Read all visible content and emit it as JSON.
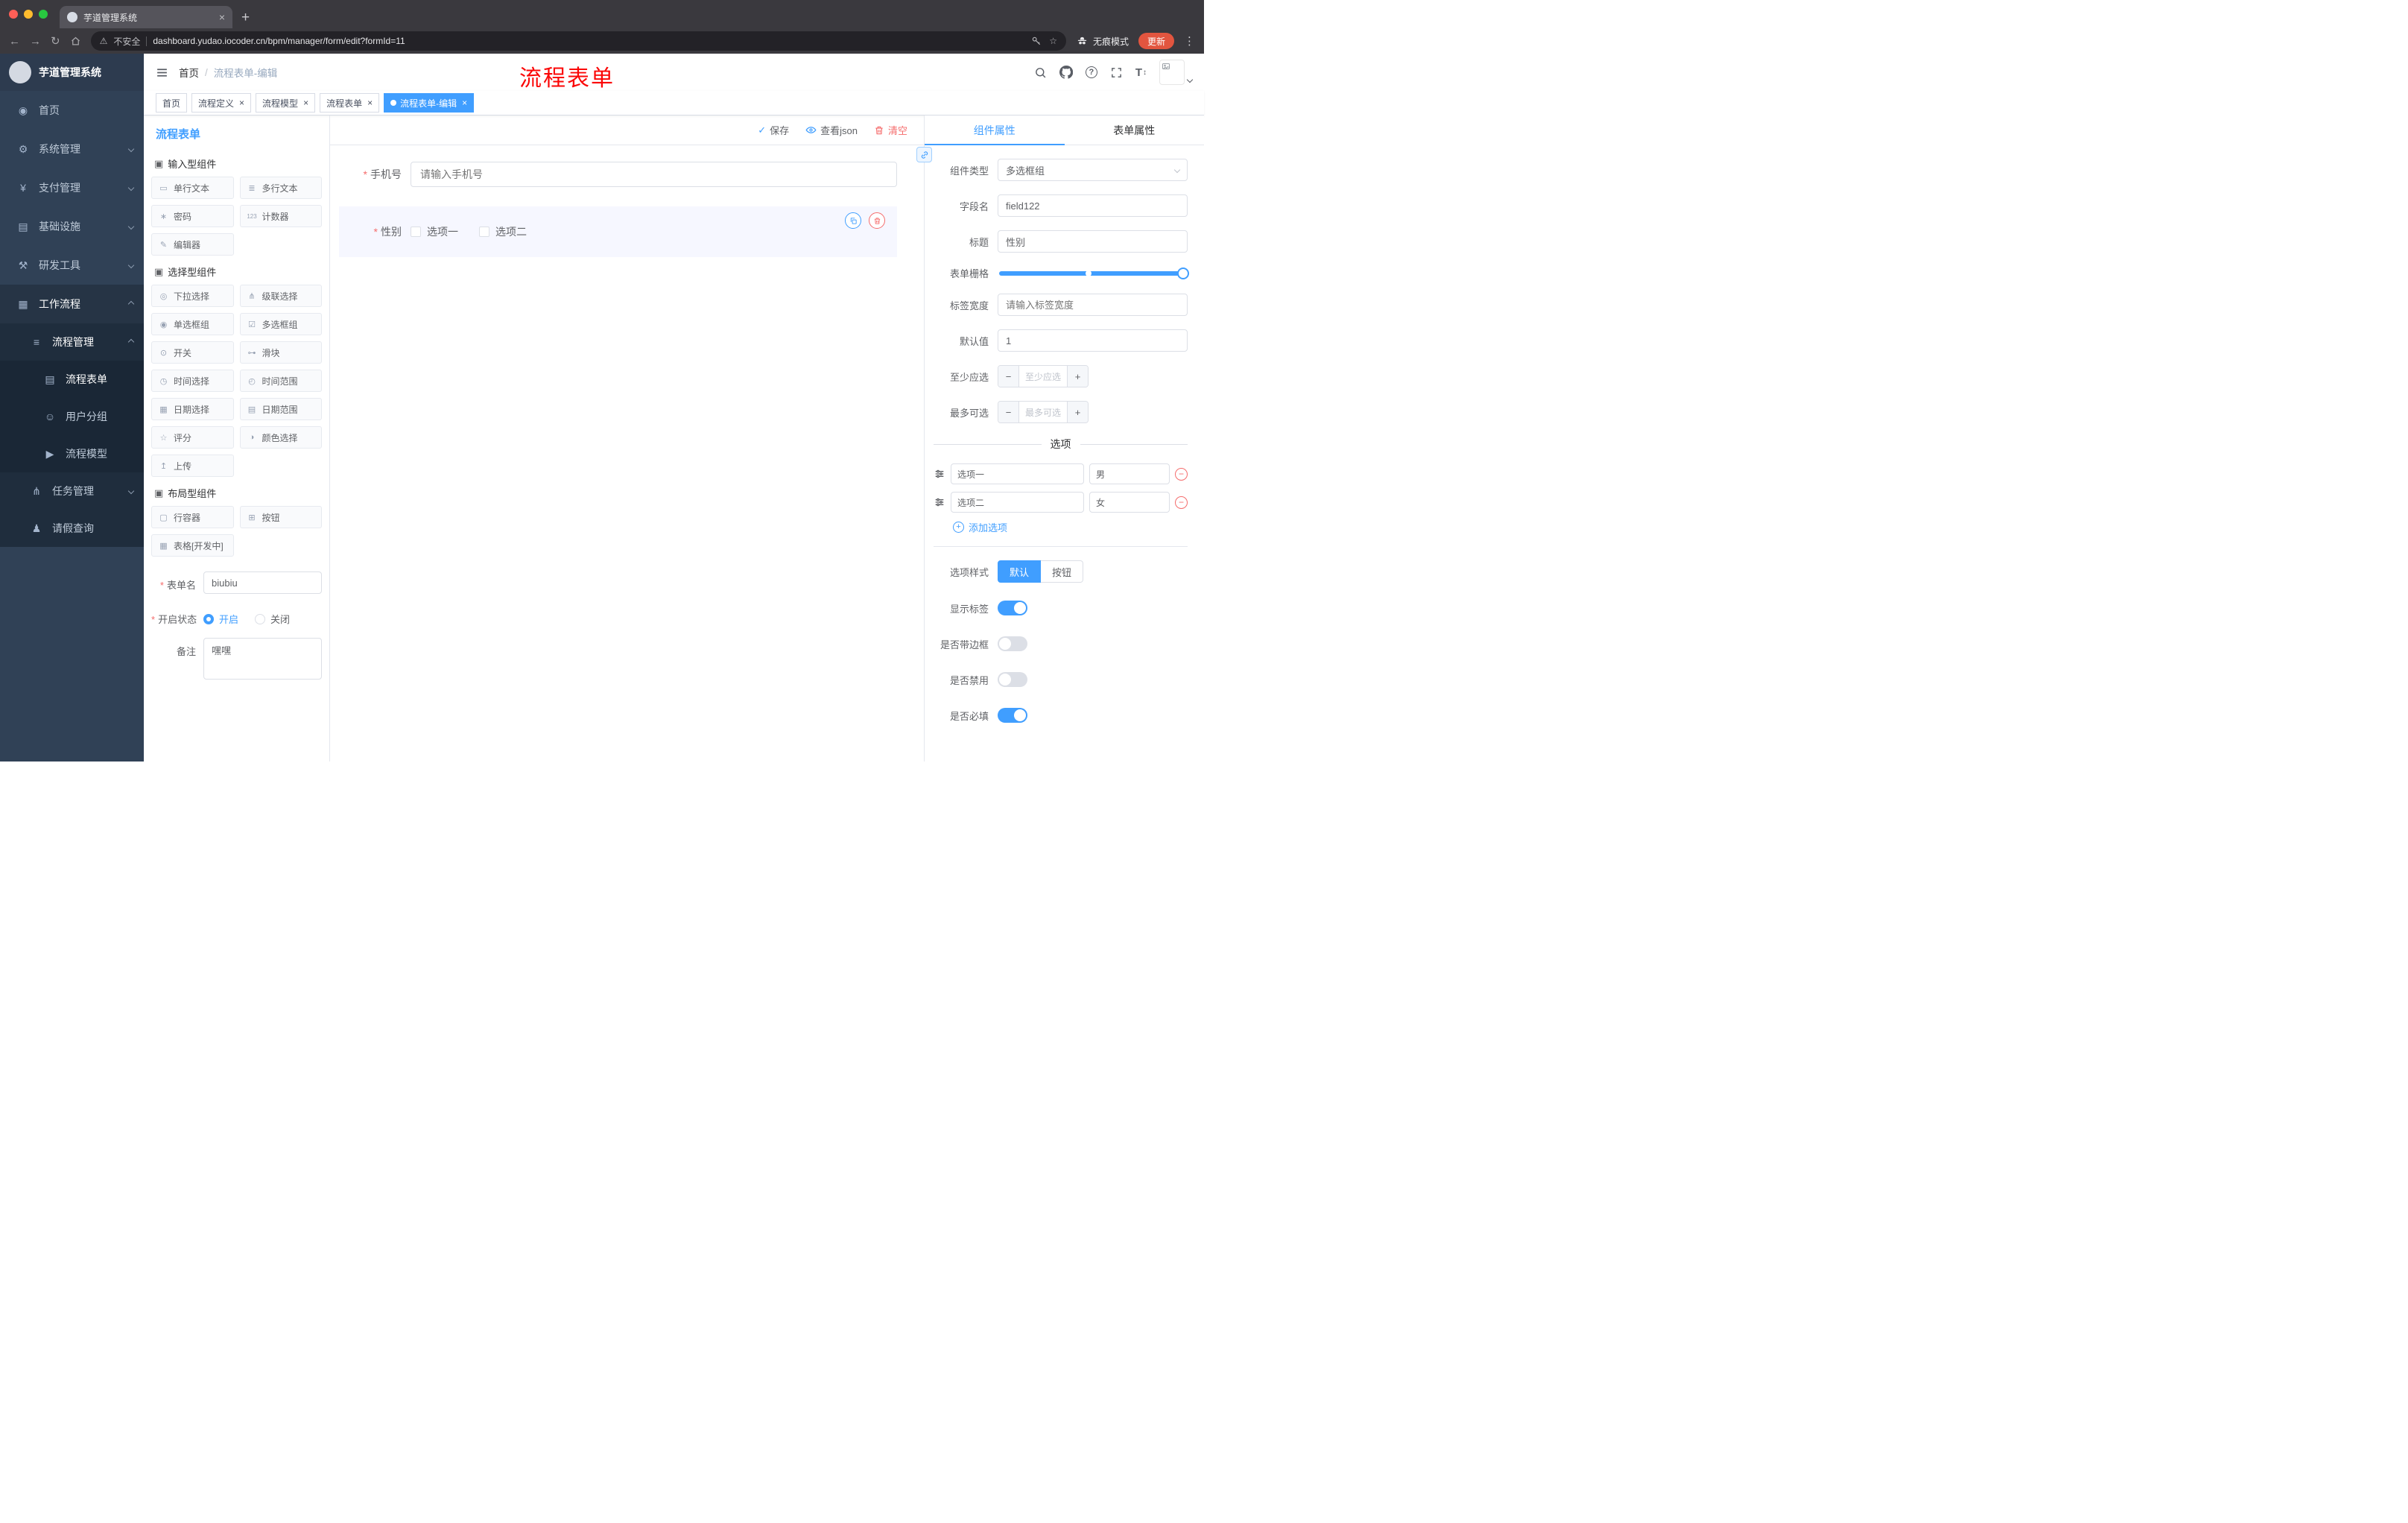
{
  "icons": {
    "back": "←",
    "forward": "→",
    "reload": "↻",
    "warning": "⚠",
    "star": "☆",
    "dots": "⋮",
    "new_tab": "+",
    "close": "×",
    "help": "?",
    "check": "✓",
    "font_size": "T",
    "updown": "↕",
    "minus": "−",
    "plus": "+",
    "section_cube": "▣"
  },
  "browser": {
    "tab_title": "芋道管理系统",
    "security_label": "不安全",
    "url": "dashboard.yudao.iocoder.cn/bpm/manager/form/edit?formId=11",
    "incognito_label": "无痕模式",
    "update_label": "更新"
  },
  "sidebar": {
    "app_title": "芋道管理系统",
    "menu": [
      {
        "icon": "◉",
        "label": "首页"
      },
      {
        "icon": "⚙",
        "label": "系统管理"
      },
      {
        "icon": "¥",
        "label": "支付管理"
      },
      {
        "icon": "▤",
        "label": "基础设施"
      },
      {
        "icon": "⚒",
        "label": "研发工具"
      },
      {
        "icon": "▦",
        "label": "工作流程"
      }
    ],
    "sub": {
      "process": {
        "icon": "≡",
        "label": "流程管理"
      },
      "children": [
        {
          "icon": "▤",
          "label": "流程表单"
        },
        {
          "icon": "☺",
          "label": "用户分组"
        },
        {
          "icon": "▶",
          "label": "流程模型"
        }
      ],
      "task": {
        "icon": "⋔",
        "label": "任务管理"
      },
      "leave": {
        "icon": "♟",
        "label": "请假查询"
      }
    }
  },
  "header": {
    "breadcrumb_home": "首页",
    "breadcrumb_sep": "/",
    "breadcrumb_current": "流程表单-编辑",
    "annotation": "流程表单"
  },
  "tags": [
    {
      "label": "首页"
    },
    {
      "label": "流程定义"
    },
    {
      "label": "流程模型"
    },
    {
      "label": "流程表单"
    },
    {
      "label": "流程表单-编辑"
    }
  ],
  "panel": {
    "title": "流程表单",
    "sections": [
      {
        "title": "输入型组件",
        "items": [
          {
            "icon": "▭",
            "label": "单行文本"
          },
          {
            "icon": "≣",
            "label": "多行文本"
          },
          {
            "icon": "∗",
            "label": "密码"
          },
          {
            "icon": "123",
            "label": "计数器"
          },
          {
            "icon": "✎",
            "label": "编辑器"
          }
        ]
      },
      {
        "title": "选择型组件",
        "items": [
          {
            "icon": "◎",
            "label": "下拉选择"
          },
          {
            "icon": "⋔",
            "label": "级联选择"
          },
          {
            "icon": "◉",
            "label": "单选框组"
          },
          {
            "icon": "☑",
            "label": "多选框组"
          },
          {
            "icon": "⊙",
            "label": "开关"
          },
          {
            "icon": "⊶",
            "label": "滑块"
          },
          {
            "icon": "◷",
            "label": "时间选择"
          },
          {
            "icon": "◴",
            "label": "时间范围"
          },
          {
            "icon": "▦",
            "label": "日期选择"
          },
          {
            "icon": "▤",
            "label": "日期范围"
          },
          {
            "icon": "☆",
            "label": "评分"
          },
          {
            "icon": "◑",
            "label": "颜色选择"
          },
          {
            "icon": "↥",
            "label": "上传"
          }
        ]
      },
      {
        "title": "布局型组件",
        "items": [
          {
            "icon": "▢",
            "label": "行容器"
          },
          {
            "icon": "⊞",
            "label": "按钮"
          },
          {
            "icon": "▦",
            "label": "表格[开发中]"
          }
        ]
      }
    ],
    "form": {
      "name_label": "表单名",
      "name_value": "biubiu",
      "status_label": "开启状态",
      "status_on": "开启",
      "status_off": "关闭",
      "remark_label": "备注",
      "remark_value": "嘿嘿"
    }
  },
  "canvas": {
    "toolbar": {
      "save": "保存",
      "view_json": "查看json",
      "clear": "清空"
    },
    "phone": {
      "label": "手机号",
      "placeholder": "请输入手机号"
    },
    "gender": {
      "label": "性别",
      "options": [
        "选项一",
        "选项二"
      ]
    }
  },
  "props": {
    "tabs": [
      "组件属性",
      "表单属性"
    ],
    "type_label": "组件类型",
    "type_value": "多选框组",
    "field_label": "字段名",
    "field_value": "field122",
    "title_label": "标题",
    "title_value": "性别",
    "grid_label": "表单栅格",
    "width_label": "标签宽度",
    "width_placeholder": "请输入标签宽度",
    "default_label": "默认值",
    "default_value": "1",
    "min_label": "至少应选",
    "min_placeholder": "至少应选",
    "max_label": "最多可选",
    "max_placeholder": "最多可选",
    "options": {
      "divider": "选项",
      "rows": [
        {
          "label": "选项一",
          "value": "男"
        },
        {
          "label": "选项二",
          "value": "女"
        }
      ],
      "add": "添加选项"
    },
    "style": {
      "label": "选项样式",
      "choices": [
        "默认",
        "按钮"
      ]
    },
    "switches": [
      {
        "label": "显示标签",
        "on": true
      },
      {
        "label": "是否带边框",
        "on": false
      },
      {
        "label": "是否禁用",
        "on": false
      },
      {
        "label": "是否必填",
        "on": true
      }
    ]
  },
  "colors": {
    "accent": "#409eff",
    "danger": "#f56c6c",
    "sidebar": "#304156",
    "update_button": "#e2553f",
    "annotation": "#fb0606"
  }
}
